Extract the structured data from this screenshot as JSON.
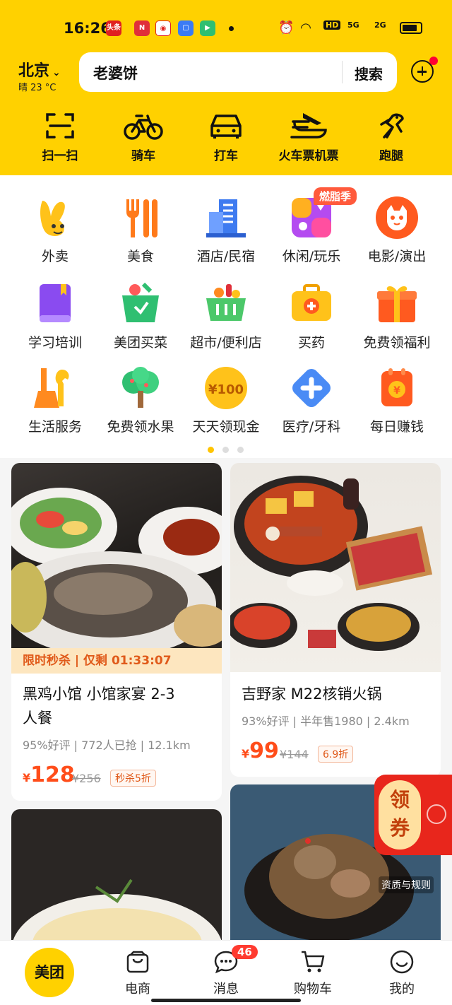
{
  "status": {
    "time": "16:26",
    "hd": "HD",
    "net1": "5G",
    "net2": "2G"
  },
  "location": {
    "city": "北京",
    "weather": "晴 23 °C"
  },
  "search": {
    "value": "老婆饼",
    "button": "搜索"
  },
  "quick_actions": [
    {
      "label": "扫一扫",
      "icon": "scan-icon"
    },
    {
      "label": "骑车",
      "icon": "bike-icon"
    },
    {
      "label": "打车",
      "icon": "taxi-icon"
    },
    {
      "label": "火车票机票",
      "icon": "train-plane-icon"
    },
    {
      "label": "跑腿",
      "icon": "errand-icon"
    }
  ],
  "categories": [
    {
      "label": "外卖",
      "icon": "takeout-icon"
    },
    {
      "label": "美食",
      "icon": "food-icon"
    },
    {
      "label": "酒店/民宿",
      "icon": "hotel-icon"
    },
    {
      "label": "休闲/玩乐",
      "icon": "leisure-icon"
    },
    {
      "label": "电影/演出",
      "icon": "movie-icon"
    },
    {
      "label": "学习培训",
      "icon": "book-icon"
    },
    {
      "label": "美团买菜",
      "icon": "grocery-icon"
    },
    {
      "label": "超市/便利店",
      "icon": "basket-icon"
    },
    {
      "label": "买药",
      "icon": "medicine-box-icon"
    },
    {
      "label": "免费领福利",
      "icon": "gift-icon"
    },
    {
      "label": "生活服务",
      "icon": "tools-icon"
    },
    {
      "label": "免费领水果",
      "icon": "tree-icon"
    },
    {
      "label": "天天领现金",
      "icon": "cash-coin-icon"
    },
    {
      "label": "医疗/牙科",
      "icon": "medical-cross-icon"
    },
    {
      "label": "每日赚钱",
      "icon": "money-bag-icon"
    }
  ],
  "hot_badge": "燃脂季",
  "coin_text": "¥100",
  "card1": {
    "flash": "限时秒杀 | 仅剩 01:33:07",
    "title_line1": "黑鸡小馆 小馆家宴 2-3",
    "title_line2": "人餐",
    "meta": "95%好评 | 772人已抢 | 12.1km",
    "currency": "¥",
    "price": "128",
    "old_price": "¥256",
    "tag": "秒杀5折"
  },
  "card2": {
    "title": "吉野家 M22核销火锅",
    "meta": "93%好评 | 半年售1980 | 2.4km",
    "currency": "¥",
    "price": "99",
    "old_price": "¥144",
    "tag": "6.9折"
  },
  "coupon": {
    "line1": "领",
    "line2": "券",
    "rules": "资质与规则"
  },
  "nav": {
    "home": "美团",
    "items": [
      {
        "label": "电商",
        "icon": "shop-bag-icon"
      },
      {
        "label": "消息",
        "icon": "chat-icon"
      },
      {
        "label": "购物车",
        "icon": "cart-icon"
      },
      {
        "label": "我的",
        "icon": "smile-icon"
      }
    ],
    "msg_count": "46"
  },
  "colors": {
    "brand": "#FFD100",
    "price": "#ff4d1a",
    "badge": "#ff3b30"
  }
}
